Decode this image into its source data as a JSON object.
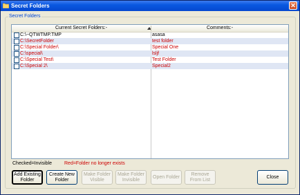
{
  "window": {
    "title": "Secret Folders",
    "close_glyph": "✕",
    "icon": "folder-icon",
    "accent": "#0a58e0"
  },
  "group": {
    "legend": "Secret Folders"
  },
  "list": {
    "columns": [
      "Current Secret Folders:-",
      "Comments:-"
    ],
    "rows": [
      {
        "path": "C:\\~QTWTMP.TMP",
        "comment": "asasa",
        "checked": false,
        "missing": false
      },
      {
        "path": "C:\\SecretFolder",
        "comment": "test folder",
        "checked": false,
        "missing": true
      },
      {
        "path": "C:\\Special Folder\\",
        "comment": "Special One",
        "checked": false,
        "missing": true
      },
      {
        "path": "C:\\special\\",
        "comment": "lsljf",
        "checked": false,
        "missing": true
      },
      {
        "path": "C:\\Special Test\\",
        "comment": "Test Folder",
        "checked": false,
        "missing": true
      },
      {
        "path": "C:\\Special 2\\",
        "comment": "Special2",
        "checked": false,
        "missing": true
      }
    ],
    "missing_color": "#cc0000",
    "ok_color": "#000000"
  },
  "legend": {
    "checked": "Checked=Invisible",
    "red": "Red=Folder no longer exists"
  },
  "buttons": {
    "add_existing": [
      "Add Existing",
      "Folder"
    ],
    "create_new": [
      "Create New",
      "Folder"
    ],
    "make_visible": [
      "Make Folder",
      "Visible"
    ],
    "make_invisible": [
      "Make Folder",
      "Invisible"
    ],
    "open_folder": "Open Folder",
    "remove": [
      "Remove",
      "From List"
    ],
    "close": "Close"
  }
}
